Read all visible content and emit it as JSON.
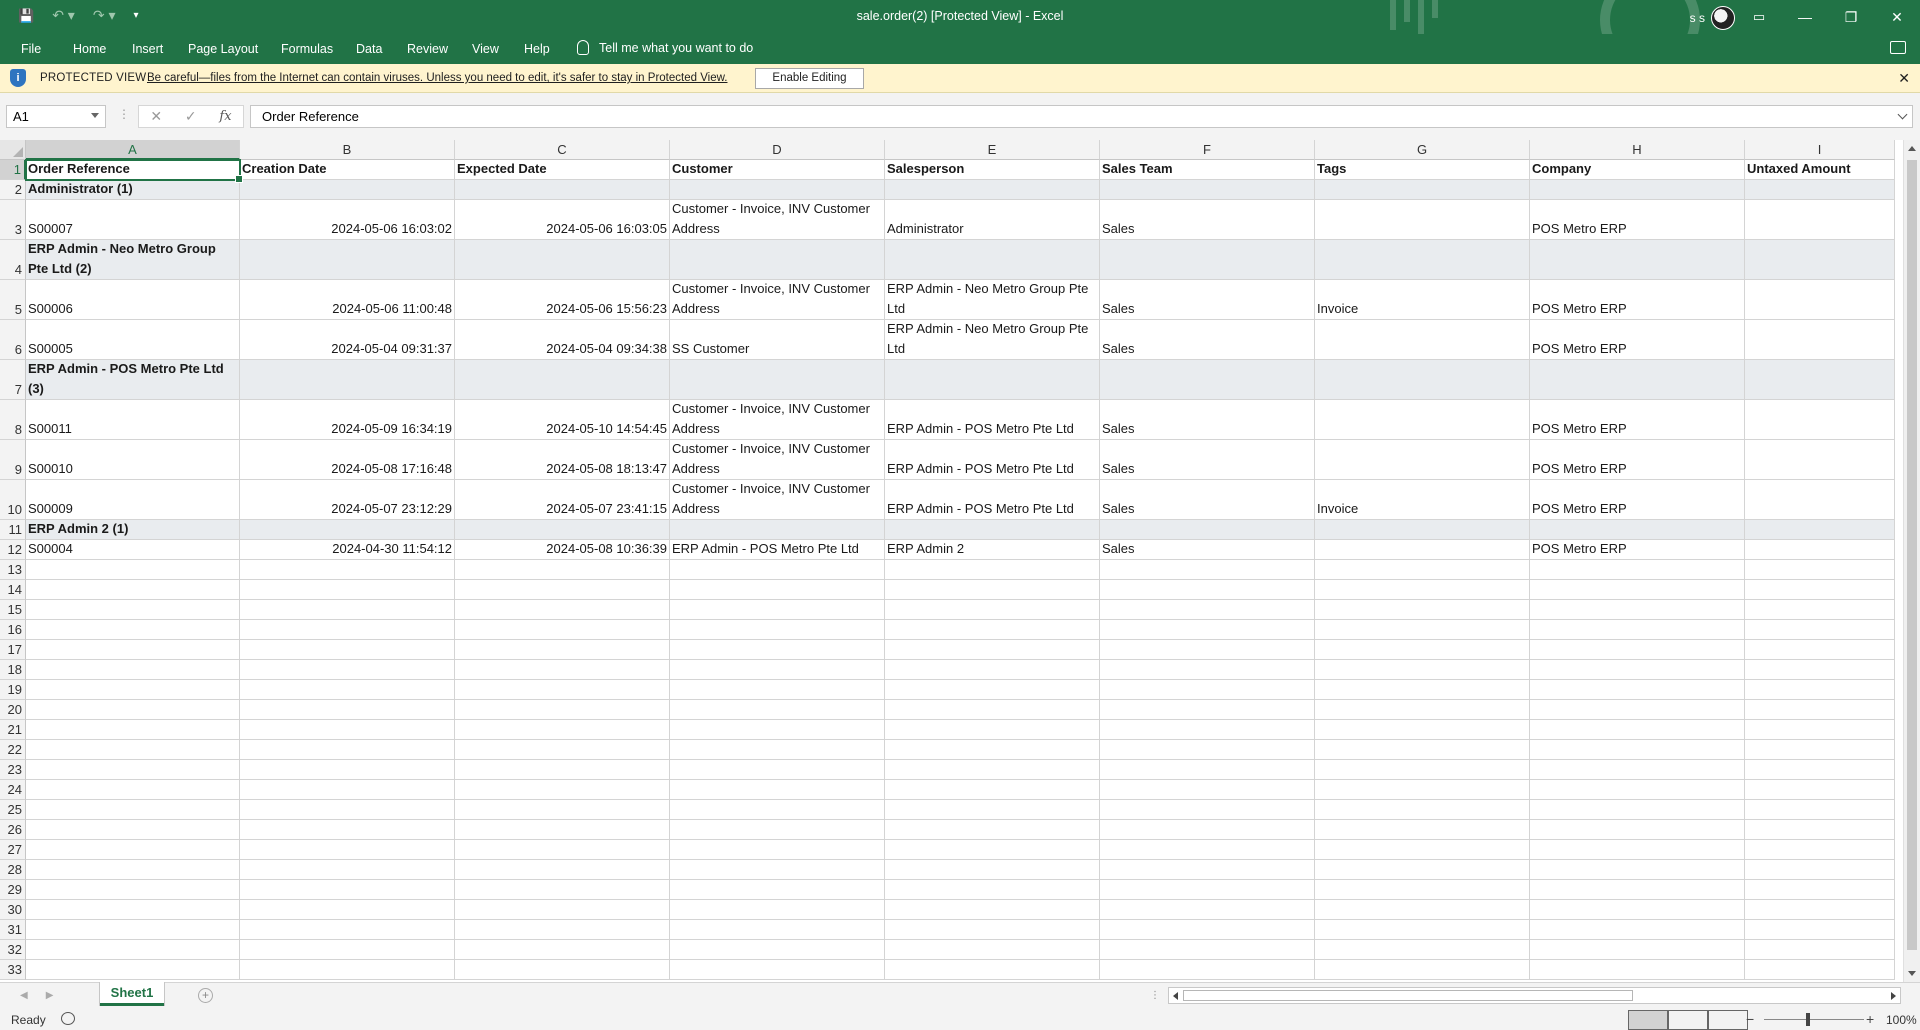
{
  "window": {
    "title": "sale.order(2)  [Protected View]  -  Excel",
    "user_initials": "s s",
    "minimize": "—",
    "restore": "❐",
    "close": "✕"
  },
  "qat": {
    "save": "💾",
    "undo": "↶ ▾",
    "redo": "↷ ▾",
    "customize": "▾"
  },
  "menu": {
    "items": [
      {
        "label": "File"
      },
      {
        "label": "Home"
      },
      {
        "label": "Insert"
      },
      {
        "label": "Page Layout"
      },
      {
        "label": "Formulas"
      },
      {
        "label": "Data"
      },
      {
        "label": "Review"
      },
      {
        "label": "View"
      },
      {
        "label": "Help"
      }
    ],
    "tell_me": "Tell me what you want to do"
  },
  "protected_view": {
    "icon": "i",
    "label": "PROTECTED VIEW",
    "message": "Be careful—files from the Internet can contain viruses. Unless you need to edit, it's safer to stay in Protected View.",
    "button": "Enable Editing",
    "close": "✕"
  },
  "formula_bar": {
    "name_box": "A1",
    "cancel": "✕",
    "enter": "✓",
    "fx": "fx",
    "content": "Order Reference"
  },
  "columns": [
    "A",
    "B",
    "C",
    "D",
    "E",
    "F",
    "G",
    "H",
    "I"
  ],
  "rows": [
    {
      "n": "1",
      "type": "header",
      "cells": [
        "Order Reference",
        "Creation Date",
        "Expected Date",
        "Customer",
        "Salesperson",
        "Sales Team",
        "Tags",
        "Company",
        "Untaxed Amount"
      ]
    },
    {
      "n": "2",
      "type": "group",
      "cells": [
        "Administrator (1)",
        "",
        "",
        "",
        "",
        "",
        "",
        "",
        ""
      ]
    },
    {
      "n": "3",
      "type": "data",
      "cells": [
        "S00007",
        "2024-05-06 16:03:02",
        "2024-05-06 16:03:05",
        "Customer - Invoice, INV Customer Address",
        "Administrator",
        "Sales",
        "",
        "POS Metro ERP",
        ""
      ]
    },
    {
      "n": "4",
      "type": "group",
      "cells": [
        "ERP Admin - Neo Metro Group Pte Ltd (2)",
        "",
        "",
        "",
        "",
        "",
        "",
        "",
        ""
      ]
    },
    {
      "n": "5",
      "type": "data",
      "cells": [
        "S00006",
        "2024-05-06 11:00:48",
        "2024-05-06 15:56:23",
        "Customer - Invoice, INV Customer Address",
        "ERP Admin - Neo Metro Group Pte Ltd",
        "Sales",
        "Invoice",
        "POS Metro ERP",
        ""
      ]
    },
    {
      "n": "6",
      "type": "data",
      "cells": [
        "S00005",
        "2024-05-04 09:31:37",
        "2024-05-04 09:34:38",
        "SS Customer",
        "ERP Admin - Neo Metro Group Pte Ltd",
        "Sales",
        "",
        "POS Metro ERP",
        ""
      ]
    },
    {
      "n": "7",
      "type": "group",
      "cells": [
        "ERP Admin - POS Metro Pte Ltd (3)",
        "",
        "",
        "",
        "",
        "",
        "",
        "",
        ""
      ]
    },
    {
      "n": "8",
      "type": "data",
      "cells": [
        "S00011",
        "2024-05-09 16:34:19",
        "2024-05-10 14:54:45",
        "Customer - Invoice, INV Customer Address",
        "ERP Admin - POS Metro Pte Ltd",
        "Sales",
        "",
        "POS Metro ERP",
        ""
      ]
    },
    {
      "n": "9",
      "type": "data",
      "cells": [
        "S00010",
        "2024-05-08 17:16:48",
        "2024-05-08 18:13:47",
        "Customer - Invoice, INV Customer Address",
        "ERP Admin - POS Metro Pte Ltd",
        "Sales",
        "",
        "POS Metro ERP",
        ""
      ]
    },
    {
      "n": "10",
      "type": "data",
      "cells": [
        "S00009",
        "2024-05-07 23:12:29",
        "2024-05-07 23:41:15",
        "Customer - Invoice, INV Customer Address",
        "ERP Admin - POS Metro Pte Ltd",
        "Sales",
        "Invoice",
        "POS Metro ERP",
        ""
      ]
    },
    {
      "n": "11",
      "type": "group",
      "cells": [
        "ERP Admin 2 (1)",
        "",
        "",
        "",
        "",
        "",
        "",
        "",
        ""
      ]
    },
    {
      "n": "12",
      "type": "data",
      "cells": [
        "S00004",
        "2024-04-30 11:54:12",
        "2024-05-08 10:36:39",
        "ERP Admin - POS Metro Pte Ltd",
        "ERP Admin 2",
        "Sales",
        "",
        "POS Metro ERP",
        ""
      ]
    },
    {
      "n": "13",
      "type": "empty"
    },
    {
      "n": "14",
      "type": "empty"
    },
    {
      "n": "15",
      "type": "empty"
    },
    {
      "n": "16",
      "type": "empty"
    },
    {
      "n": "17",
      "type": "empty"
    },
    {
      "n": "18",
      "type": "empty"
    },
    {
      "n": "19",
      "type": "empty"
    },
    {
      "n": "20",
      "type": "empty"
    },
    {
      "n": "21",
      "type": "empty"
    },
    {
      "n": "22",
      "type": "empty"
    },
    {
      "n": "23",
      "type": "empty"
    },
    {
      "n": "24",
      "type": "empty"
    },
    {
      "n": "25",
      "type": "empty"
    },
    {
      "n": "26",
      "type": "empty"
    },
    {
      "n": "27",
      "type": "empty"
    },
    {
      "n": "28",
      "type": "empty"
    },
    {
      "n": "29",
      "type": "empty"
    },
    {
      "n": "30",
      "type": "empty"
    },
    {
      "n": "31",
      "type": "empty"
    },
    {
      "n": "32",
      "type": "empty"
    },
    {
      "n": "33",
      "type": "empty"
    }
  ],
  "sheets": {
    "active": "Sheet1",
    "add": "+"
  },
  "status": {
    "ready": "Ready",
    "zoom": "100%",
    "zoom_minus": "−",
    "zoom_plus": "+"
  },
  "colors": {
    "accent": "#217346",
    "protected_bg": "#fff4ce",
    "group_row_bg": "#e9ecef"
  }
}
